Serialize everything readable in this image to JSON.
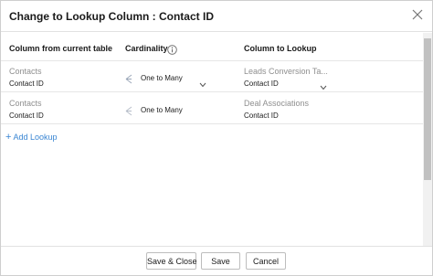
{
  "dialog": {
    "title": "Change to Lookup Column : Contact ID"
  },
  "columns": {
    "current": "Column from current table",
    "cardinality": "Cardinality",
    "lookup": "Column to Lookup"
  },
  "rows": [
    {
      "table": "Contacts",
      "column": "Contact ID",
      "cardinality": "One to Many",
      "lookup_table": "Leads Conversion Ta...",
      "lookup_column": "Contact ID"
    },
    {
      "table": "Contacts",
      "column": "Contact ID",
      "cardinality": "One to Many",
      "lookup_table": "Deal Associations",
      "lookup_column": "Contact ID"
    }
  ],
  "add_lookup": "Add Lookup",
  "buttons": {
    "save_close": "Save & Close",
    "save": "Save",
    "cancel": "Cancel"
  },
  "colors": {
    "accent": "#3a86d3",
    "muted_text": "#8f8f8f"
  }
}
